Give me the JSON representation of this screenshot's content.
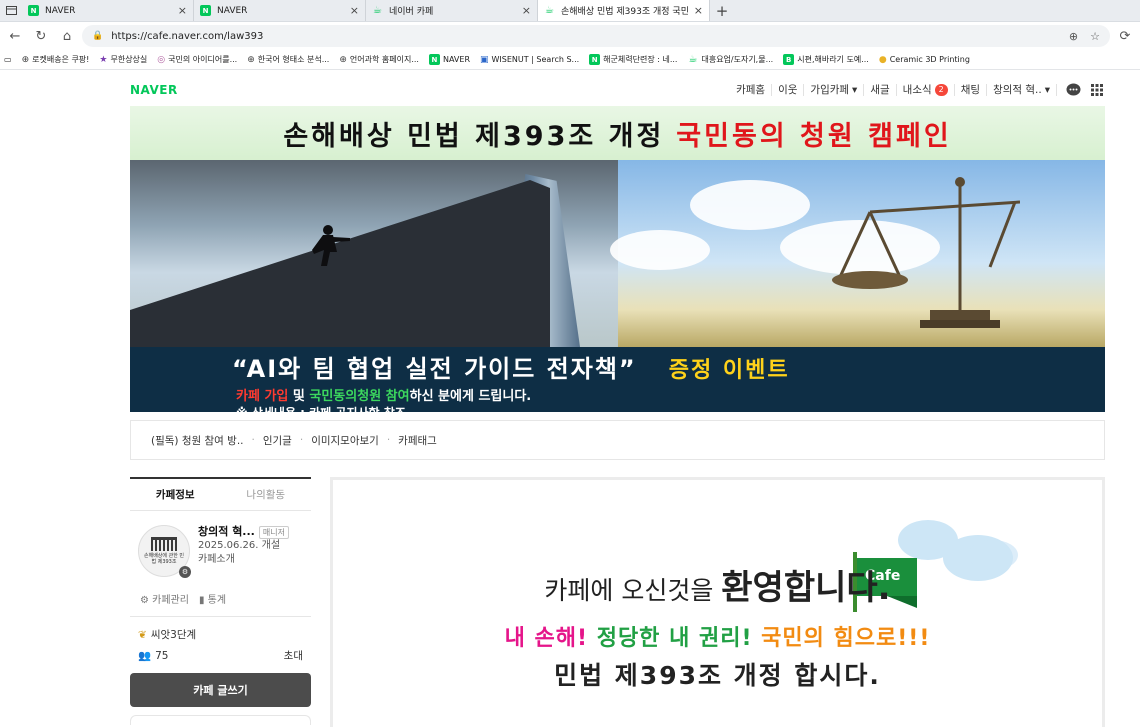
{
  "browser": {
    "tabs": [
      {
        "title": "NAVER",
        "icon": "naver-icon",
        "active": false
      },
      {
        "title": "NAVER",
        "icon": "naver-icon",
        "active": false
      },
      {
        "title": "네이버 카페",
        "icon": "cafe-icon",
        "active": false
      },
      {
        "title": "손해배상 민법 제393조 개정 국민",
        "icon": "cafe-icon",
        "active": true
      }
    ],
    "url": "https://cafe.naver.com/law393",
    "bookmarks": [
      "로켓배송은 쿠팡!",
      "무한상상실",
      "국민의 아이디어를...",
      "한국어 형태소 분석...",
      "언어과학 홈페이지...",
      "NAVER",
      "WISENUT | Search S...",
      "해군체력단련장 : 네...",
      "대흥요업/도자기,물...",
      "시편,해바라기 도예...",
      "Ceramic 3D Printing"
    ]
  },
  "gnb": {
    "logo": "NAVER",
    "items": [
      "카페홈",
      "이웃",
      "가입카페",
      "새글",
      "내소식",
      "채팅",
      "창의적 혁.."
    ],
    "notification_count": "2"
  },
  "banner": {
    "headline_black": "손해배상 민법 제393조 개정",
    "headline_red": "국민동의 청원 캠페인",
    "event_title": "“AI와 팀 협업 실전 가이드 전자책”",
    "event_label": "증정 이벤트",
    "line2_red": "카페 가입",
    "line2_mid": " 및 ",
    "line2_green": "국민동의청원 참여",
    "line2_end": "하신 분에게 드립니다.",
    "line3": "※ 상세내용 : 카페 공지사항 참조"
  },
  "menu": [
    "(필독) 청원 참여 방..",
    "인기글",
    "이미지모아보기",
    "카페태그"
  ],
  "sidebar": {
    "tabs": [
      "카페정보",
      "나의활동"
    ],
    "cafe_name": "창의적 혁...",
    "role": "매니저",
    "founded": "2025.06.26. 개설",
    "intro": "카페소개",
    "avatar_text": "손해배상에 관한 민법 제393조",
    "manage": "카페관리",
    "stats": "통계",
    "level": "씨앗3단계",
    "members": "75",
    "invite": "초대",
    "write_button": "카페 글쓰기"
  },
  "main": {
    "welcome_pre": "카페에 오신것을 ",
    "welcome_big": "환영합니다.",
    "flag_text": "Cafe",
    "slogan_1": "내 손해!",
    "slogan_2": " 정당한 내 권리!",
    "slogan_3": " 국민의 힘으로!!!",
    "line3": "민법 제393조 개정 합시다."
  },
  "colors": {
    "naver_green": "#03c75a",
    "banner_red": "#e0161b",
    "banner_navy": "#0e2e45",
    "event_yellow": "#ffd21a"
  }
}
